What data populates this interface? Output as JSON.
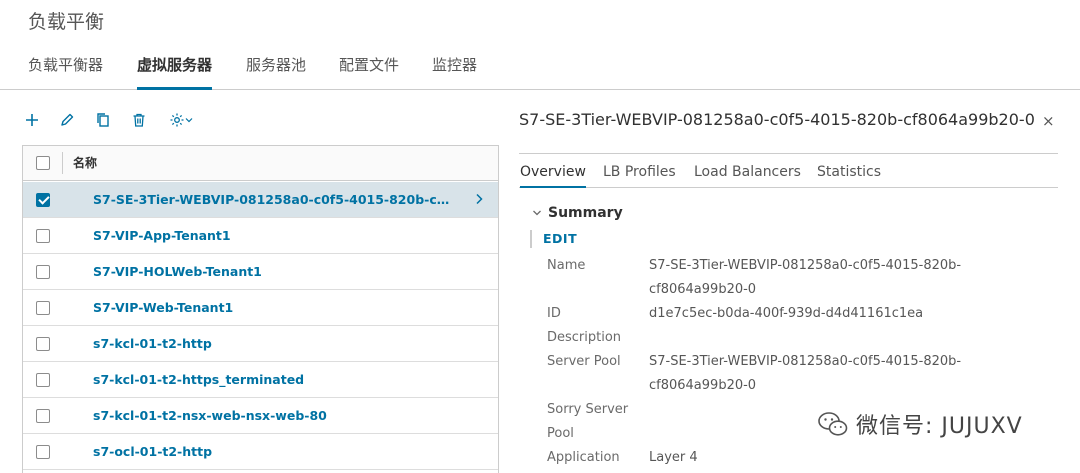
{
  "page": {
    "title": "负载平衡"
  },
  "tabs": [
    {
      "label": "负载平衡器",
      "active": false
    },
    {
      "label": "虚拟服务器",
      "active": true
    },
    {
      "label": "服务器池",
      "active": false
    },
    {
      "label": "配置文件",
      "active": false
    },
    {
      "label": "监控器",
      "active": false
    }
  ],
  "toolbar": {
    "add": "plus-icon",
    "edit": "pencil-icon",
    "copy": "copy-icon",
    "delete": "trash-icon",
    "settings": "gear-dropdown-icon"
  },
  "grid": {
    "column_name": "名称",
    "rows": [
      {
        "name": "S7-SE-3Tier-WEBVIP-081258a0-c0f5-4015-820b-cf8…",
        "checked": true
      },
      {
        "name": "S7-VIP-App-Tenant1",
        "checked": false
      },
      {
        "name": "S7-VIP-HOLWeb-Tenant1",
        "checked": false
      },
      {
        "name": "S7-VIP-Web-Tenant1",
        "checked": false
      },
      {
        "name": "s7-kcl-01-t2-http",
        "checked": false
      },
      {
        "name": "s7-kcl-01-t2-https_terminated",
        "checked": false
      },
      {
        "name": "s7-kcl-01-t2-nsx-web-nsx-web-80",
        "checked": false
      },
      {
        "name": "s7-ocl-01-t2-http",
        "checked": false
      }
    ]
  },
  "detail": {
    "title": "S7-SE-3Tier-WEBVIP-081258a0-c0f5-4015-820b-cf8064a99b20-0",
    "close": "×",
    "tabs": [
      {
        "label": "Overview",
        "active": true
      },
      {
        "label": "LB Profiles",
        "active": false
      },
      {
        "label": "Load Balancers",
        "active": false
      },
      {
        "label": "Statistics",
        "active": false
      }
    ],
    "summary_label": "Summary",
    "edit_label": "EDIT",
    "fields": {
      "name_label": "Name",
      "name_value_1": "S7-SE-3Tier-WEBVIP-081258a0-c0f5-4015-820b-",
      "name_value_2": "cf8064a99b20-0",
      "id_label": "ID",
      "id_value": "d1e7c5ec-b0da-400f-939d-d4d41161c1ea",
      "description_label": "Description",
      "server_pool_label": "Server Pool",
      "server_pool_value_1": "S7-SE-3Tier-WEBVIP-081258a0-c0f5-4015-820b-",
      "server_pool_value_2": "cf8064a99b20-0",
      "sorry_server_label_1": "Sorry Server",
      "sorry_server_label_2": "Pool",
      "application_label": "Application",
      "application_value": "Layer 4"
    }
  },
  "watermark": {
    "text": "微信号: JUJUXV",
    "icon": "wechat-icon"
  }
}
